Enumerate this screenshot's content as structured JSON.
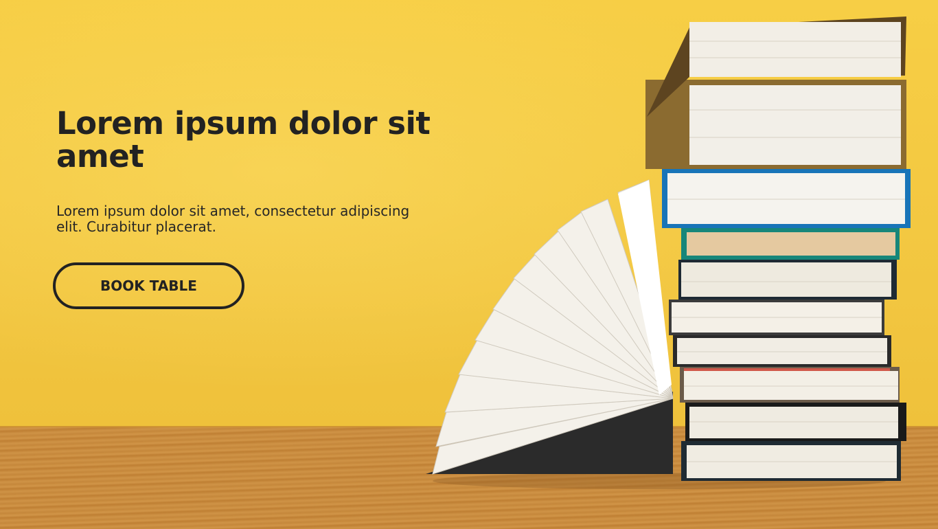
{
  "hero": {
    "title": "Lorem ipsum dolor sit amet",
    "subtitle": "Lorem ipsum dolor sit amet, consectetur adipiscing elit. Curabitur placerat.",
    "cta_label": "BOOK TABLE"
  },
  "image": {
    "subject": "stack-of-books-icon"
  },
  "colors": {
    "wall": "#f2c640",
    "table": "#c88a3c",
    "text": "#222222",
    "button_border": "#222222"
  }
}
